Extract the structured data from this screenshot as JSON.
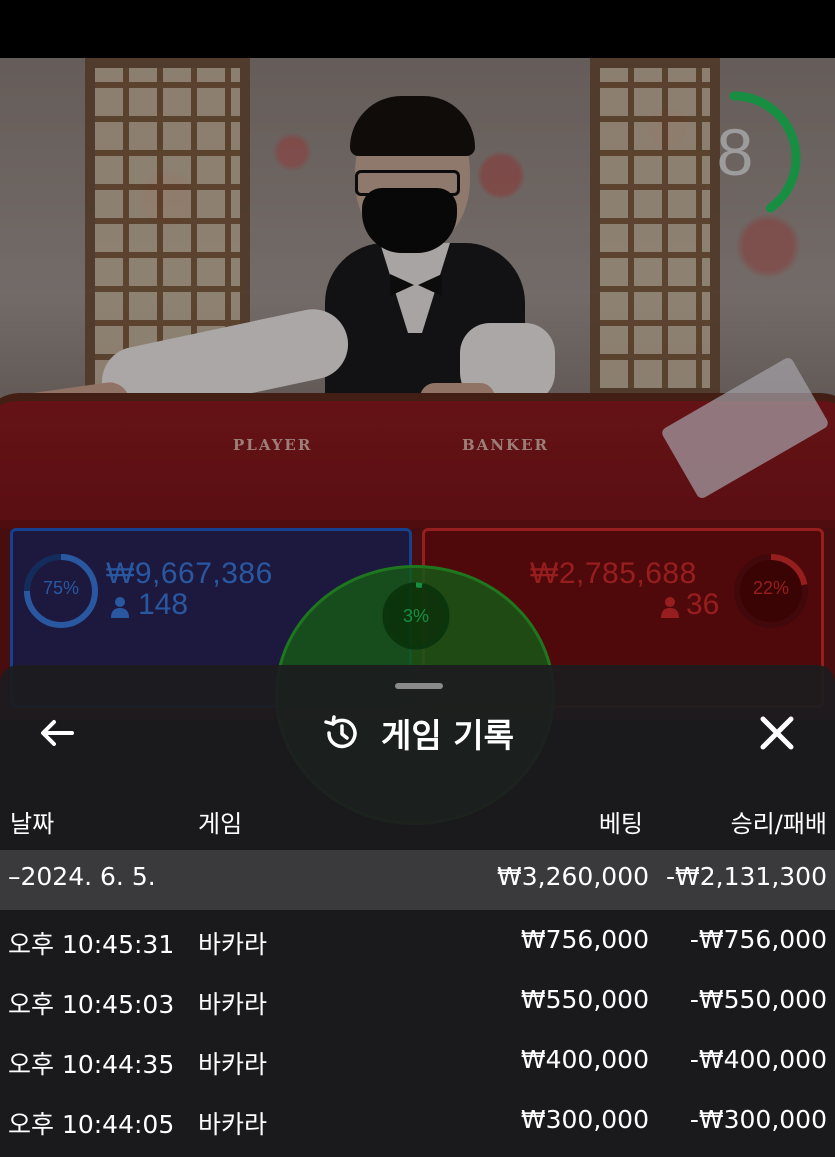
{
  "video": {
    "table_labels": {
      "player": "PLAYER",
      "banker": "BANKER"
    },
    "countdown": {
      "value": "8",
      "progress": 0.4,
      "color": "#22c55e"
    }
  },
  "betting": {
    "player": {
      "percent": "75%",
      "amount": "₩9,667,386",
      "bettors": "148",
      "color": "#3a7be0"
    },
    "banker": {
      "percent": "22%",
      "amount": "₩2,785,688",
      "bettors": "36",
      "color": "#d12a2a"
    },
    "tie": {
      "percent": "3%",
      "color": "#2aa62a"
    }
  },
  "history_sheet": {
    "title": "게임 기록",
    "icons": {
      "back": "back-arrow-icon",
      "history": "history-clock-icon",
      "close": "close-icon"
    },
    "columns": {
      "date": "날짜",
      "game": "게임",
      "bet": "베팅",
      "result": "승리/패배"
    },
    "summary": {
      "date": "–2024. 6. 5.",
      "bet": "₩3,260,000",
      "result": "-₩2,131,300"
    },
    "rows": [
      {
        "time": "오후 10:45:31",
        "game": "바카라",
        "bet": "₩756,000",
        "result": "-₩756,000"
      },
      {
        "time": "오후 10:45:03",
        "game": "바카라",
        "bet": "₩550,000",
        "result": "-₩550,000"
      },
      {
        "time": "오후 10:44:35",
        "game": "바카라",
        "bet": "₩400,000",
        "result": "-₩400,000"
      },
      {
        "time": "오후 10:44:05",
        "game": "바카라",
        "bet": "₩300,000",
        "result": "-₩300,000"
      }
    ]
  }
}
